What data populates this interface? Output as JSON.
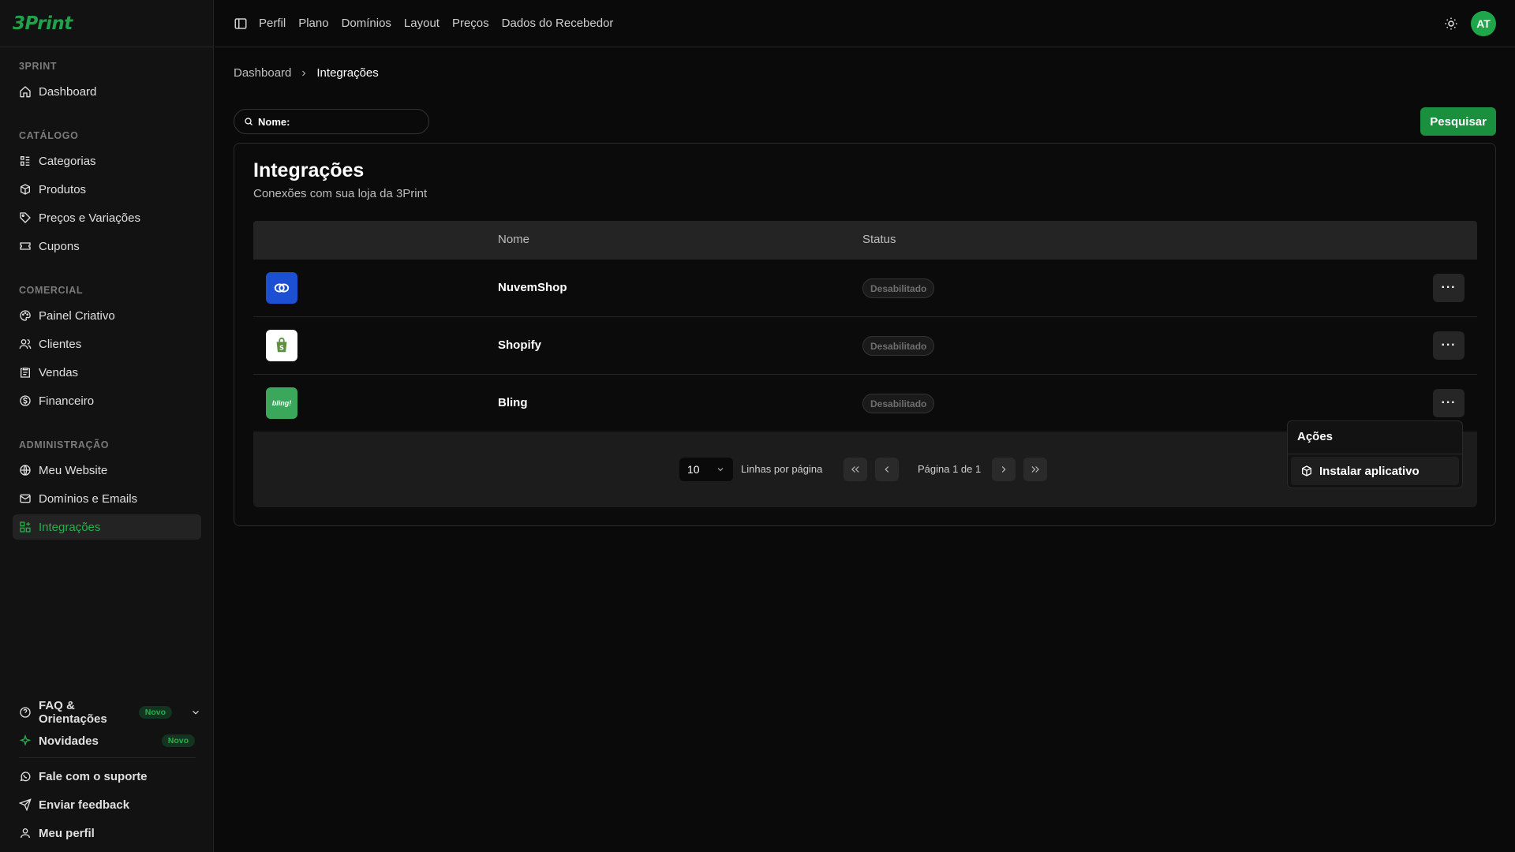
{
  "brand": {
    "logo": "3Print",
    "color": "#22a04b"
  },
  "sidebar": {
    "sections": [
      {
        "label": "3PRINT",
        "items": [
          {
            "label": "Dashboard",
            "icon": "home-icon"
          }
        ]
      },
      {
        "label": "CATÁLOGO",
        "items": [
          {
            "label": "Categorias",
            "icon": "category-icon"
          },
          {
            "label": "Produtos",
            "icon": "box-icon"
          },
          {
            "label": "Preços e Variações",
            "icon": "tag-icon"
          },
          {
            "label": "Cupons",
            "icon": "ticket-icon"
          }
        ]
      },
      {
        "label": "COMERCIAL",
        "items": [
          {
            "label": "Painel Criativo",
            "icon": "palette-icon"
          },
          {
            "label": "Clientes",
            "icon": "users-icon"
          },
          {
            "label": "Vendas",
            "icon": "clipboard-icon"
          },
          {
            "label": "Financeiro",
            "icon": "dollar-icon"
          }
        ]
      },
      {
        "label": "ADMINISTRAÇÃO",
        "items": [
          {
            "label": "Meu Website",
            "icon": "globe-icon"
          },
          {
            "label": "Domínios e Emails",
            "icon": "mail-icon"
          },
          {
            "label": "Integrações",
            "icon": "grid-icon",
            "active": true
          }
        ]
      }
    ],
    "footer": {
      "faq": "FAQ & Orientações",
      "faq_badge": "Novo",
      "news": "Novidades",
      "news_badge": "Novo",
      "support": "Fale com o suporte",
      "feedback": "Enviar feedback",
      "profile": "Meu perfil"
    }
  },
  "topbar": {
    "links": [
      "Perfil",
      "Plano",
      "Domínios",
      "Layout",
      "Preços",
      "Dados do Recebedor"
    ],
    "avatar": "AT"
  },
  "breadcrumb": {
    "root": "Dashboard",
    "current": "Integrações"
  },
  "search": {
    "placeholder": "Nome:",
    "button": "Pesquisar"
  },
  "card": {
    "title": "Integrações",
    "subtitle": "Conexões com sua loja da 3Print",
    "columns": {
      "name": "Nome",
      "status": "Status"
    },
    "rows": [
      {
        "name": "NuvemShop",
        "status": "Desabilitado",
        "logo_color": "#1c4fd1"
      },
      {
        "name": "Shopify",
        "status": "Desabilitado",
        "logo_color": "#ffffff"
      },
      {
        "name": "Bling",
        "status": "Desabilitado",
        "logo_color": "#3aa75a",
        "logo_text": "bling!"
      }
    ],
    "pagination": {
      "rows_per_page": "10",
      "rows_label": "Linhas por página",
      "page_info": "Página 1 de 1"
    }
  },
  "dropdown": {
    "title": "Ações",
    "item": "Instalar aplicativo"
  }
}
